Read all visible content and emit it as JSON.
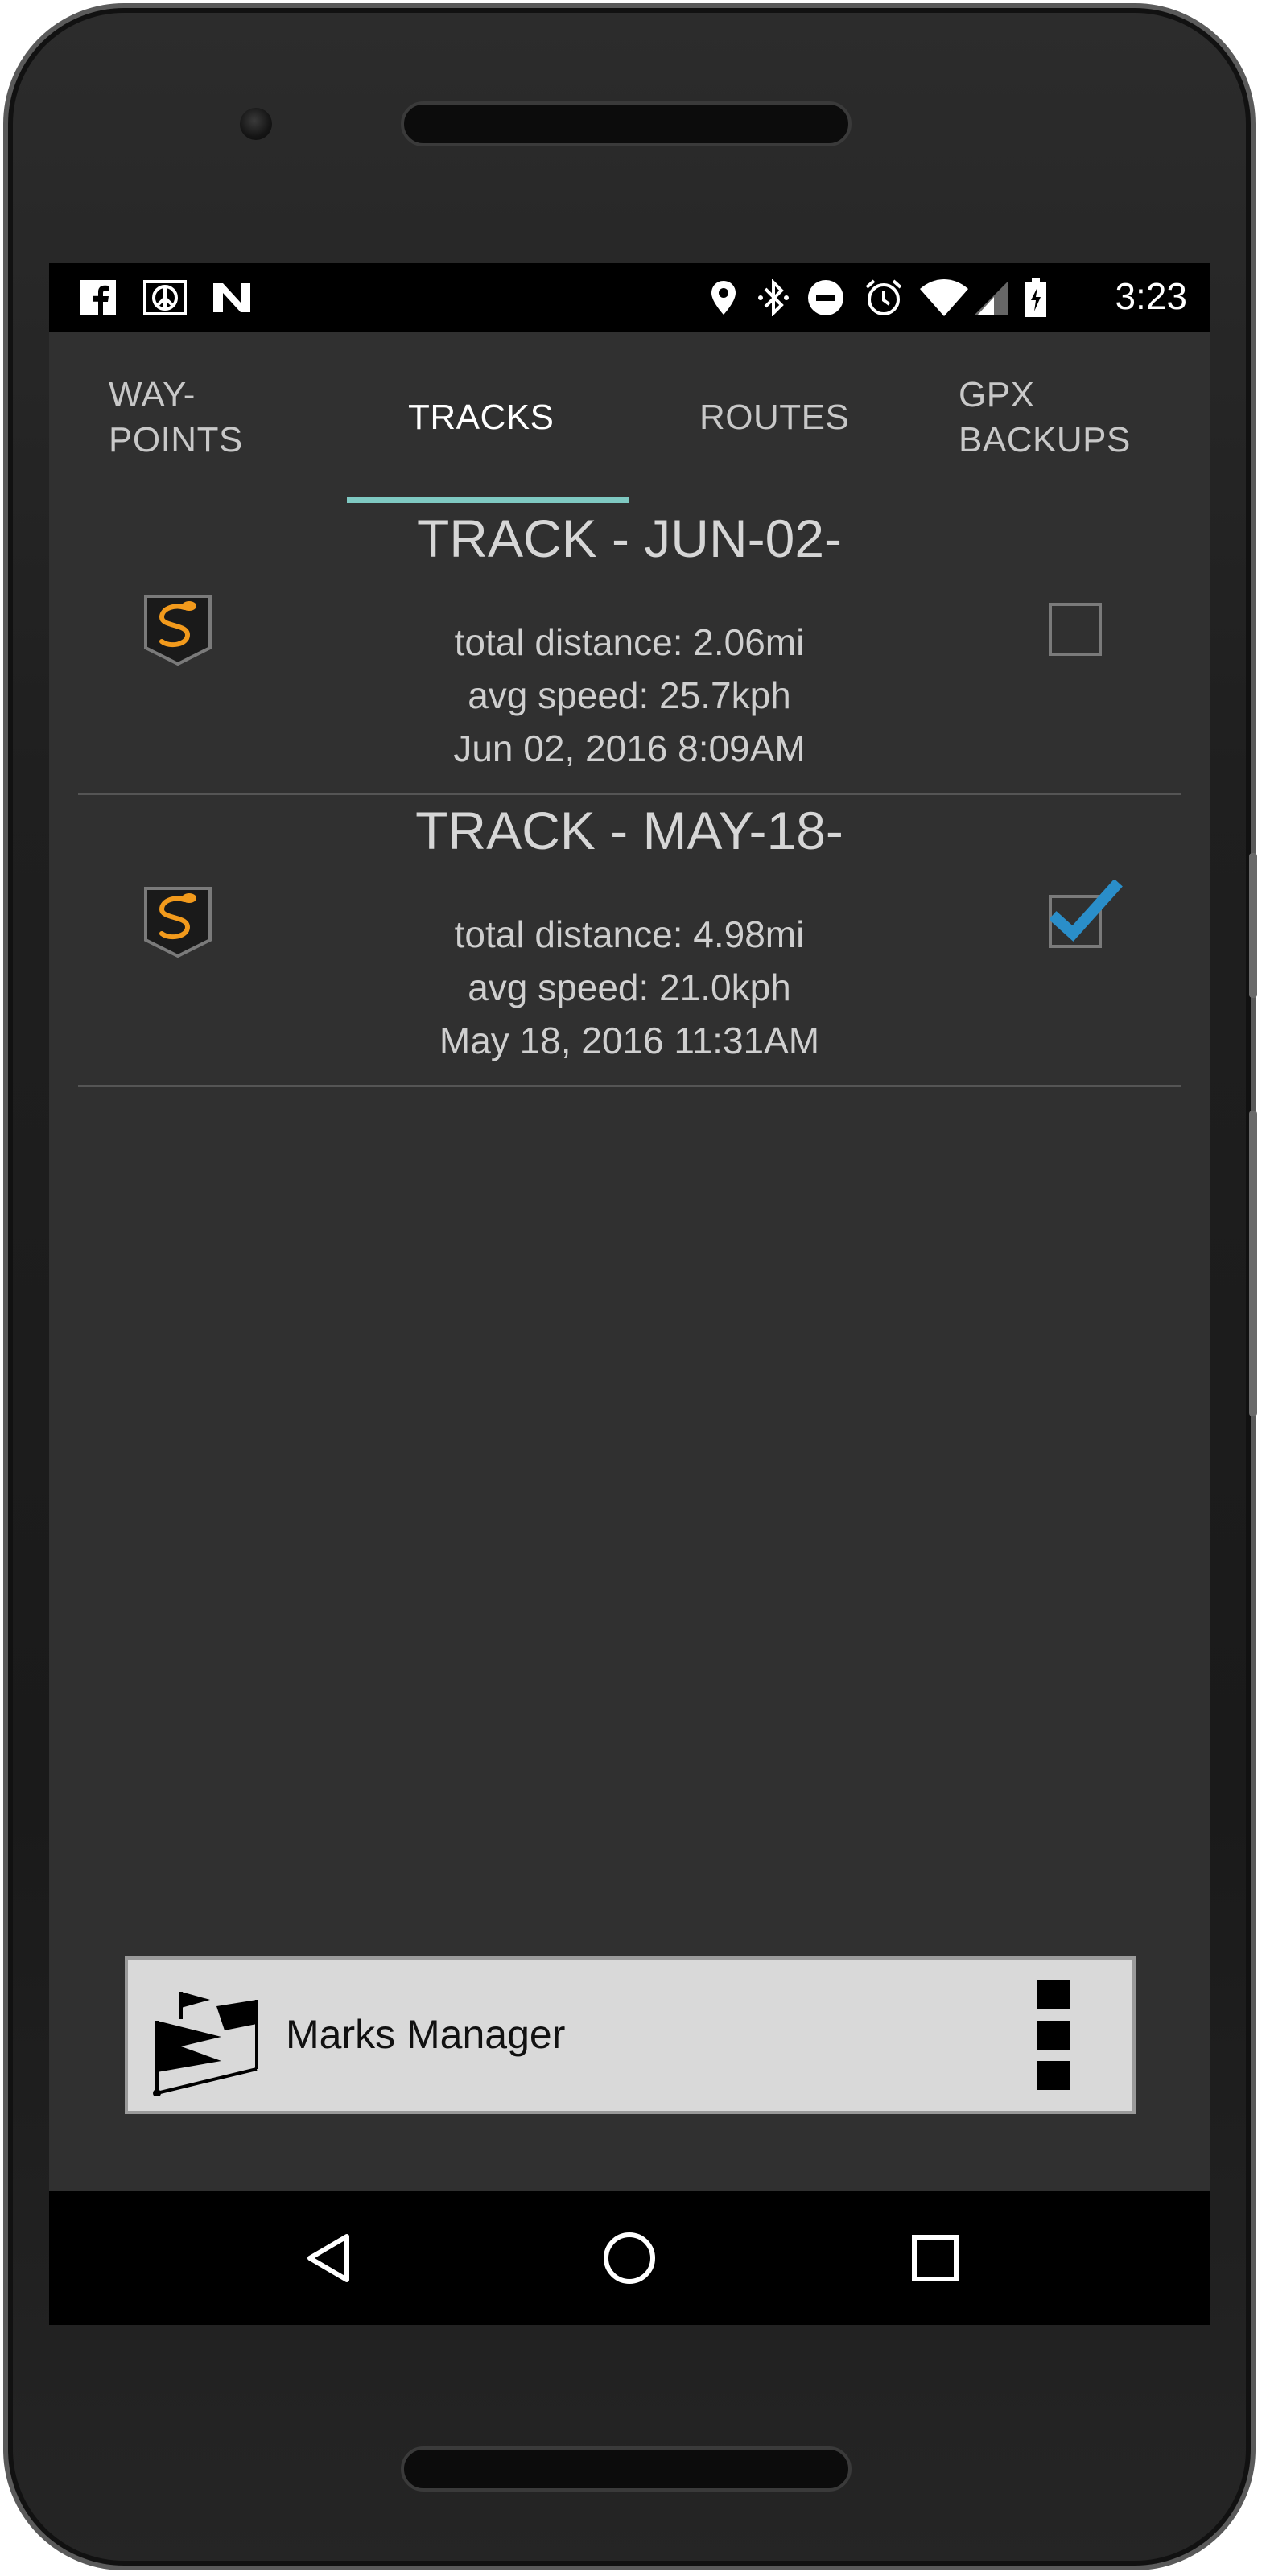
{
  "status_bar": {
    "left_icons": [
      "facebook-icon",
      "peace-icon",
      "n-icon"
    ],
    "right_icons": [
      "location-icon",
      "bluetooth-icon",
      "do-not-disturb-icon",
      "alarm-icon",
      "wifi-icon",
      "signal-icon",
      "battery-charging-icon"
    ],
    "time": "3:23"
  },
  "tabs": [
    {
      "line1": "WAY-",
      "line2": "POINTS",
      "active": false
    },
    {
      "line1": "TRACKS",
      "line2": "",
      "active": true
    },
    {
      "line1": "ROUTES",
      "line2": "",
      "active": false
    },
    {
      "line1": "GPX",
      "line2": "BACKUPS",
      "active": false
    }
  ],
  "tracks": [
    {
      "title": "TRACK - JUN-02-",
      "distance": "total distance: 2.06mi",
      "speed": "avg speed: 25.7kph",
      "date": "Jun 02, 2016 8:09AM",
      "checked": false
    },
    {
      "title": "TRACK - MAY-18-",
      "distance": "total distance: 4.98mi",
      "speed": "avg speed: 21.0kph",
      "date": "May 18, 2016 11:31AM",
      "checked": true
    }
  ],
  "bottom_bar": {
    "label": "Marks Manager",
    "icon": "flags-icon",
    "menu_icon": "overflow-menu-icon"
  },
  "nav": [
    "back-icon",
    "home-icon",
    "recents-icon"
  ],
  "colors": {
    "screen_bg": "#303030",
    "tab_indicator": "#7fc9c2",
    "checkmark": "#2a8ec9",
    "track_icon_orange": "#f29a1c"
  }
}
